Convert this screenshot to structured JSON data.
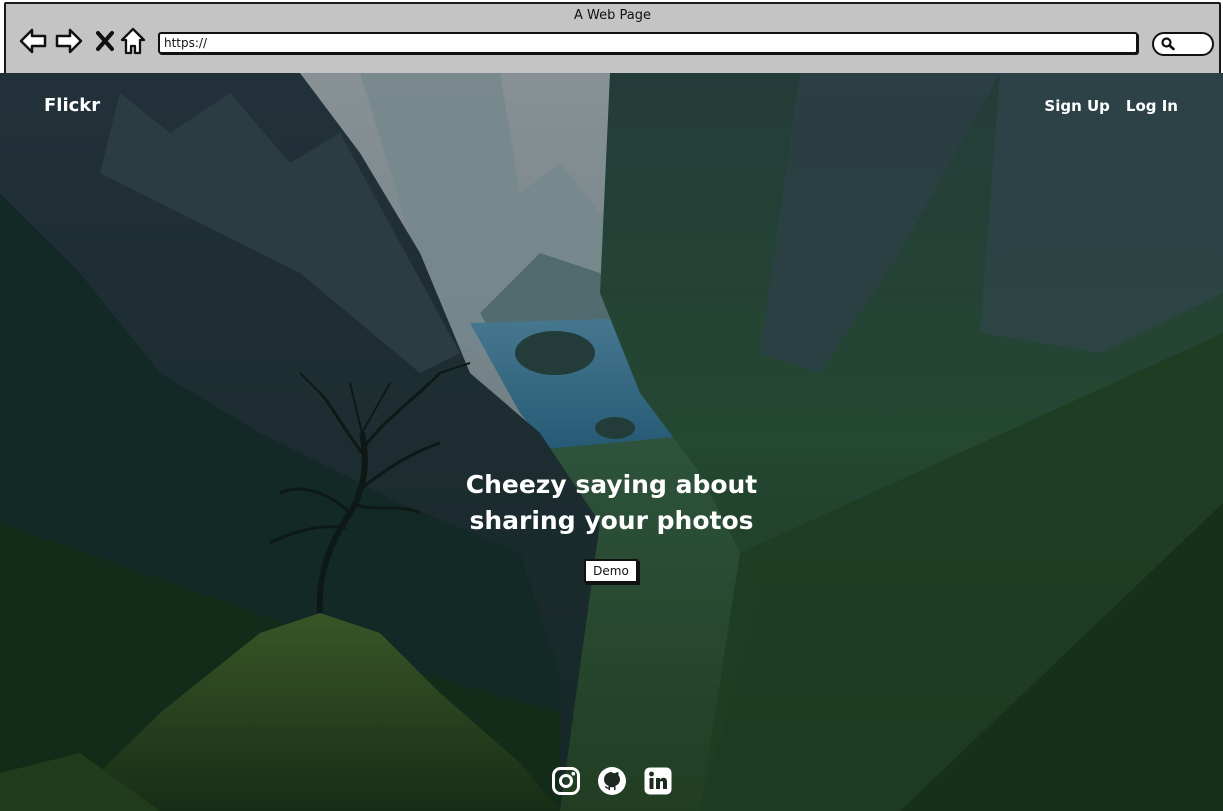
{
  "window": {
    "title": "A Web Page",
    "url_value": "https://"
  },
  "browser_icons": {
    "back": "back-arrow-icon",
    "forward": "forward-arrow-icon",
    "stop": "close-icon",
    "home": "home-icon",
    "search": "search-icon"
  },
  "nav": {
    "brand": "Flickr",
    "signup": "Sign Up",
    "login": "Log In"
  },
  "hero": {
    "headline": "Cheezy saying about sharing your photos",
    "demo_label": "Demo"
  },
  "socials": [
    {
      "icon": "instagram-icon"
    },
    {
      "icon": "github-icon"
    },
    {
      "icon": "linkedin-icon"
    }
  ],
  "colors": {
    "chrome": "#c4c4c4",
    "text_on_hero": "#ffffff"
  }
}
